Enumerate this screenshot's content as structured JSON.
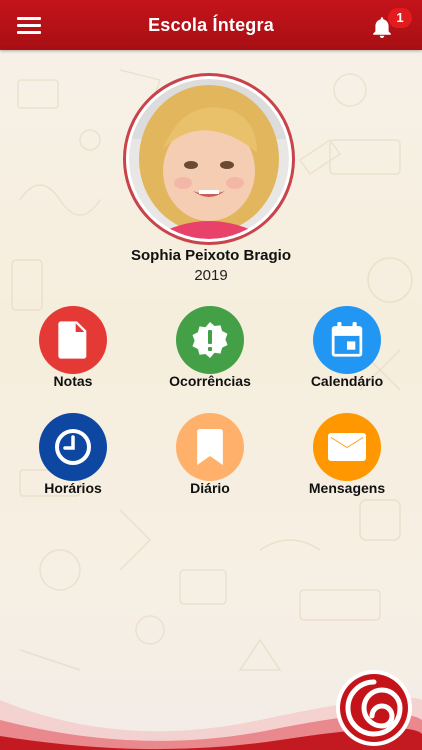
{
  "app": {
    "title": "Escola Íntegra",
    "notification_count": "1",
    "colors": {
      "primary": "#b5121b",
      "header_gradient_top": "#c4141a",
      "header_gradient_bottom": "#a70f14"
    }
  },
  "student": {
    "name": "Sophia Peixoto Bragio",
    "year": "2019"
  },
  "menu": [
    {
      "label": "Notas",
      "icon": "document-icon",
      "color": "#e53935"
    },
    {
      "label": "Ocorrências",
      "icon": "alert-badge-icon",
      "color": "#43a047"
    },
    {
      "label": "Calendário",
      "icon": "calendar-icon",
      "color": "#2196f3"
    },
    {
      "label": "Horários",
      "icon": "clock-icon",
      "color": "#0d47a1"
    },
    {
      "label": "Diário",
      "icon": "bookmark-icon",
      "color": "#ffb06a"
    },
    {
      "label": "Mensagens",
      "icon": "envelope-icon",
      "color": "#ff9800"
    }
  ]
}
